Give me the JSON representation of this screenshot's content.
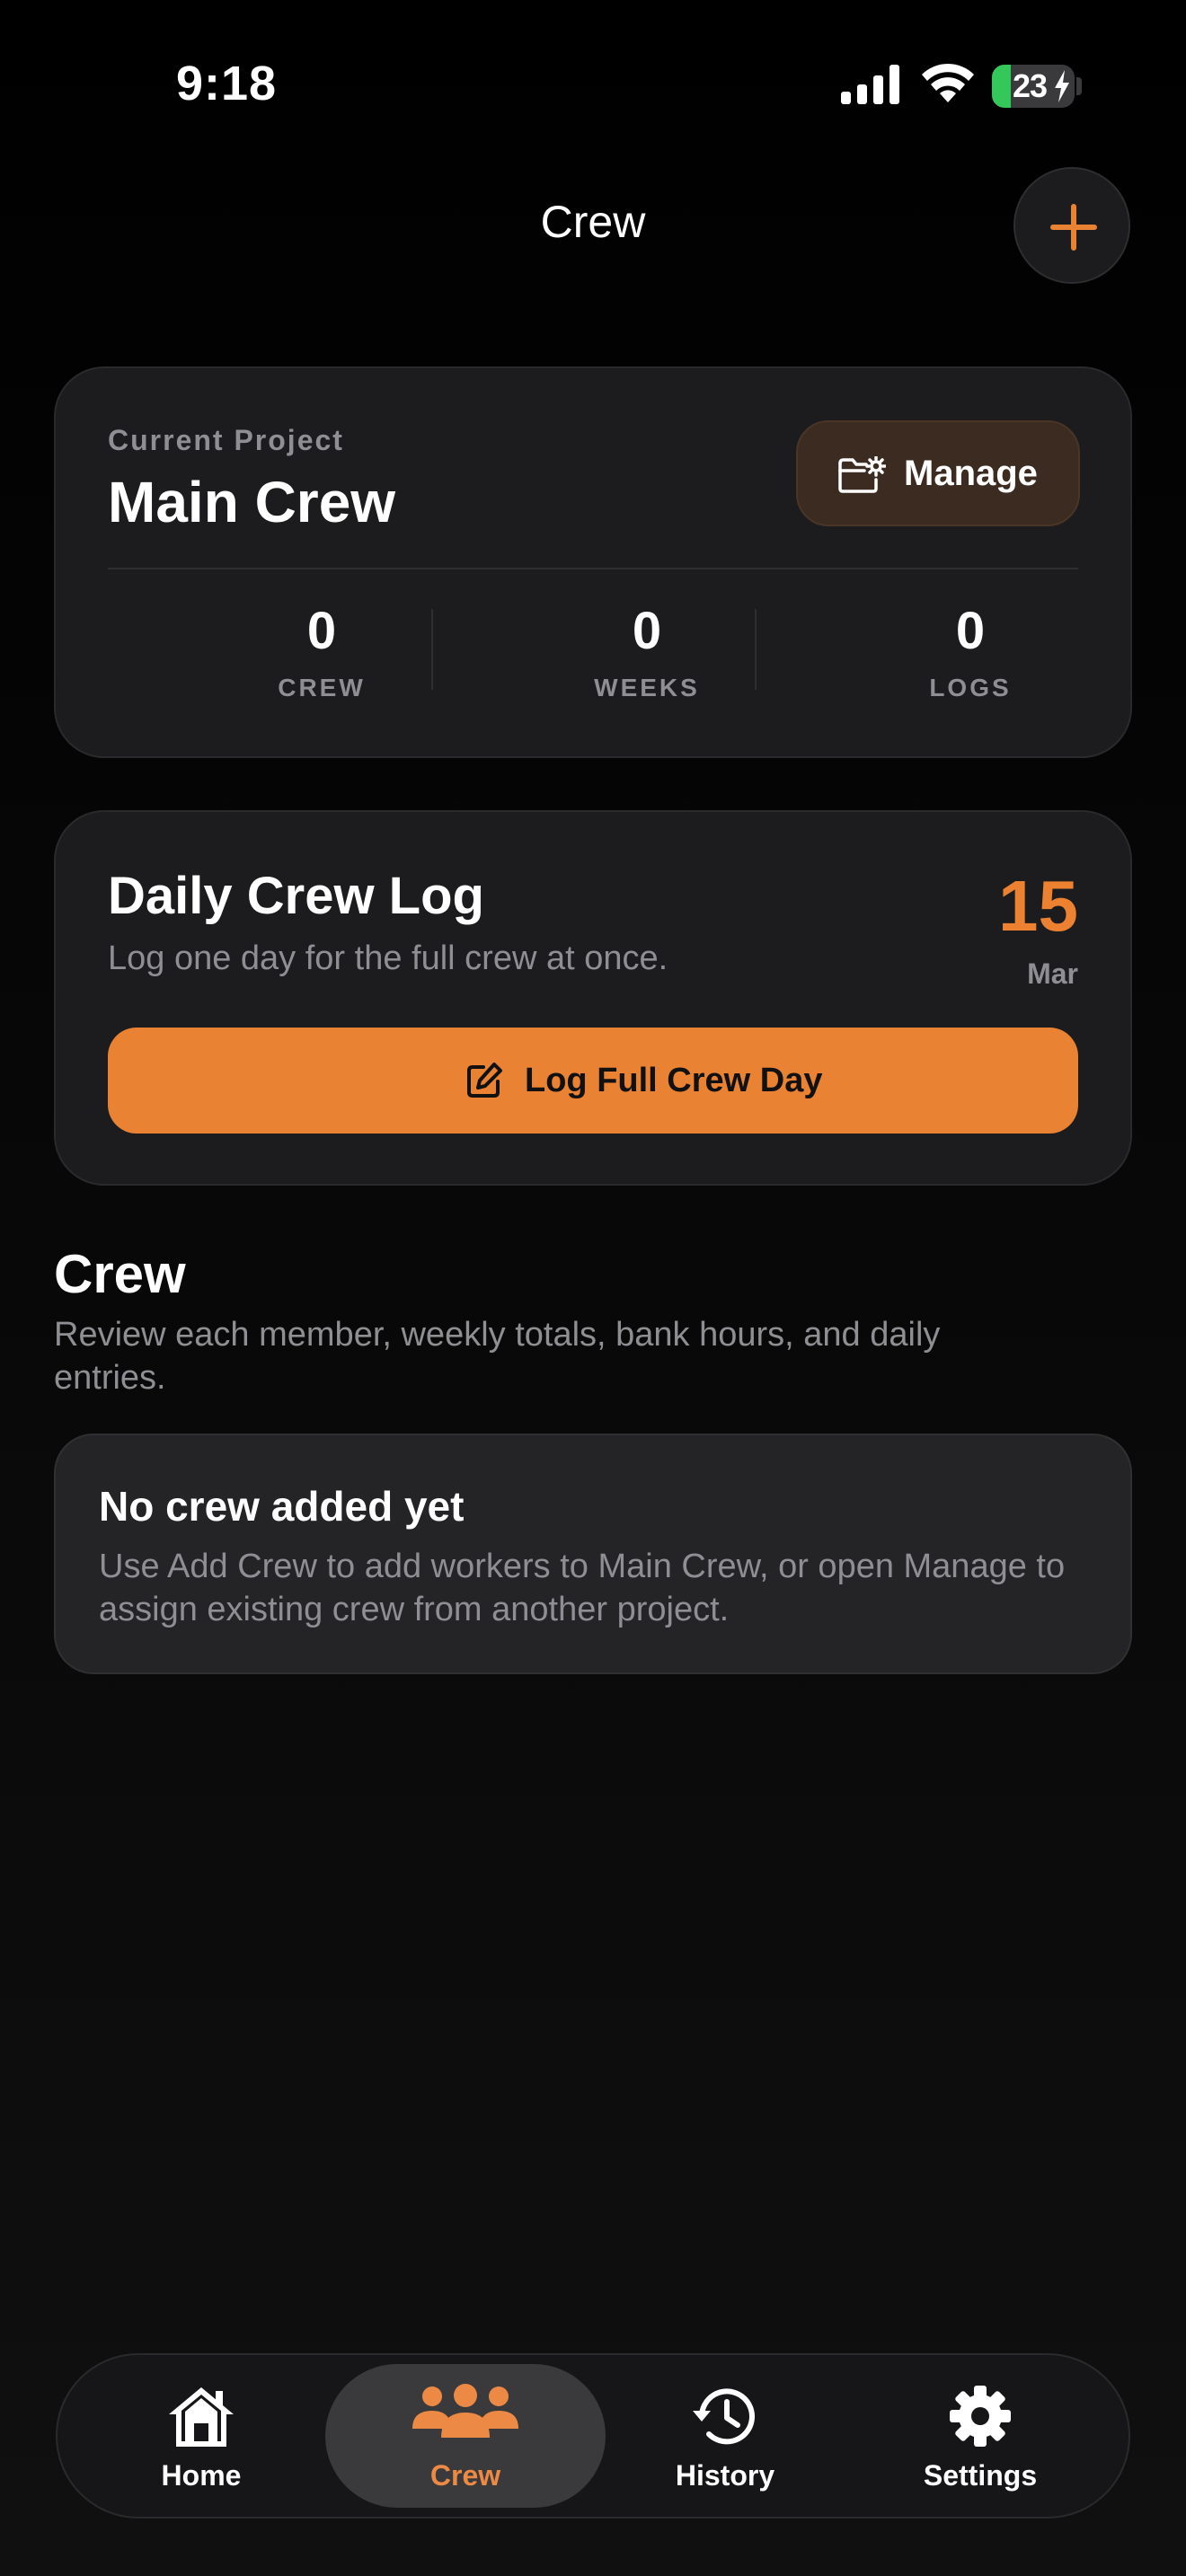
{
  "status_bar": {
    "time": "9:18",
    "battery_level": "23",
    "battery_percent": 23,
    "battery_color": "#34c759",
    "icons": [
      "signal-icon",
      "wifi-icon",
      "battery-icon",
      "charging-bolt-icon"
    ]
  },
  "header": {
    "title": "Crew",
    "add_icon": "plus-icon"
  },
  "project": {
    "label": "Current Project",
    "name": "Main Crew",
    "manage_label": "Manage",
    "manage_icon": "folder-gear-icon",
    "stats": [
      {
        "value": "0",
        "label": "CREW"
      },
      {
        "value": "0",
        "label": "WEEKS"
      },
      {
        "value": "0",
        "label": "LOGS"
      }
    ]
  },
  "daily_log": {
    "title": "Daily Crew Log",
    "subtitle": "Log one day for the full crew at once.",
    "date_day": "15",
    "date_month": "Mar",
    "button_label": "Log Full Crew Day",
    "button_icon": "edit-square-icon"
  },
  "crew_section": {
    "title": "Crew",
    "subtitle": "Review each member, weekly totals, bank hours, and daily entries."
  },
  "empty_state": {
    "title": "No crew added yet",
    "text": "Use Add Crew to add workers to Main Crew, or open Manage to assign existing crew from another project."
  },
  "tab_bar": {
    "active": "Crew",
    "tabs": [
      {
        "label": "Home",
        "icon": "house-icon"
      },
      {
        "label": "Crew",
        "icon": "people-icon"
      },
      {
        "label": "History",
        "icon": "history-clock-icon"
      },
      {
        "label": "Settings",
        "icon": "gear-icon"
      }
    ]
  },
  "colors": {
    "accent": "#ea8233",
    "background": "#000000",
    "card": "#1c1c1e",
    "secondary_text": "#8e8e93"
  }
}
